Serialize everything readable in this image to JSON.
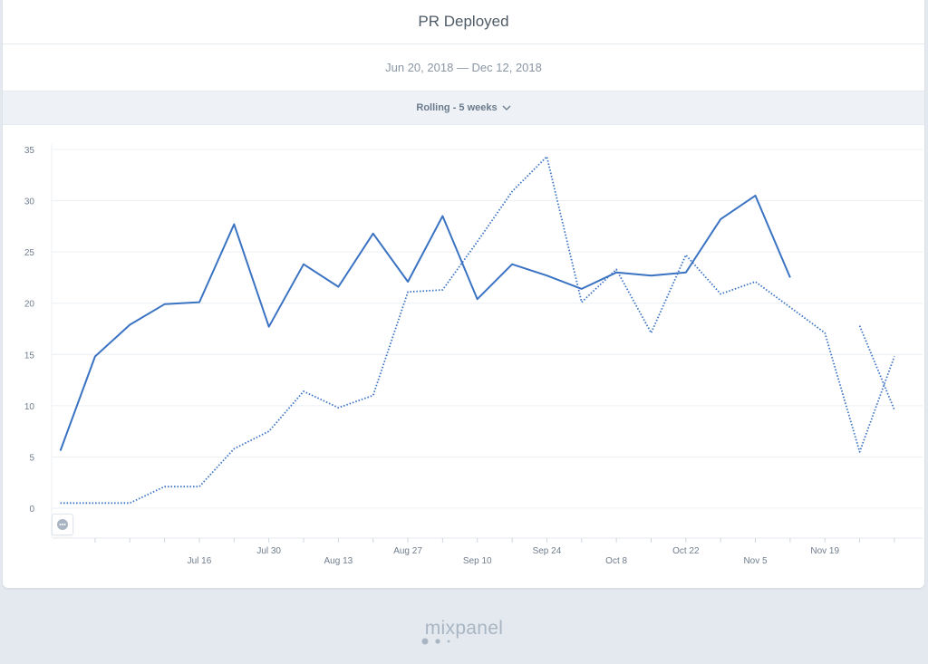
{
  "header": {
    "title": "PR Deployed"
  },
  "date_range": "Jun 20, 2018 — Dec 12, 2018",
  "rolling": {
    "label": "Rolling - 5 weeks"
  },
  "logo": "mixpanel",
  "colors": {
    "line": "#3b73c3",
    "grid": "#eceff3",
    "tick_text": "#6f7d8c",
    "background": "#e3e9ef"
  },
  "chart_data": {
    "type": "line",
    "ylim": [
      0,
      35
    ],
    "y_ticks": [
      0,
      5,
      10,
      15,
      20,
      25,
      30,
      35
    ],
    "x_ticks": [
      {
        "label": "Jul 16",
        "x": 4
      },
      {
        "label": "Jul 30",
        "x": 6
      },
      {
        "label": "Aug 13",
        "x": 8
      },
      {
        "label": "Aug 27",
        "x": 10
      },
      {
        "label": "Sep 10",
        "x": 12
      },
      {
        "label": "Sep 24",
        "x": 14
      },
      {
        "label": "Oct 8",
        "x": 16
      },
      {
        "label": "Oct 22",
        "x": 18
      },
      {
        "label": "Nov 5",
        "x": 20
      },
      {
        "label": "Nov 19",
        "x": 22
      }
    ],
    "x_range": [
      -0.25,
      24.55
    ],
    "series": [
      {
        "style": "solid",
        "x": [
          0,
          1,
          2,
          3,
          4,
          5,
          6,
          7,
          8,
          9,
          10,
          11,
          12,
          13,
          14,
          15,
          16,
          17,
          18,
          19,
          20,
          21,
          22,
          23,
          24
        ],
        "values": [
          5.6,
          14.8,
          17.9,
          19.9,
          20.1,
          27.7,
          17.7,
          23.8,
          21.6,
          26.8,
          22.1,
          28.5,
          20.4,
          23.8,
          22.7,
          21.4,
          23.0,
          22.7,
          23.0,
          28.2,
          30.5,
          22.5,
          null,
          17.8,
          null
        ]
      },
      {
        "style": "dotted",
        "x": [
          0,
          1,
          2,
          3,
          4,
          5,
          6,
          7,
          8,
          9,
          10,
          11,
          12,
          13,
          14,
          15,
          16,
          17,
          18,
          19,
          20,
          21,
          22,
          23,
          24
        ],
        "values": [
          0.5,
          0.5,
          0.5,
          2.1,
          2.1,
          5.8,
          7.5,
          11.4,
          9.8,
          11.0,
          21.1,
          21.3,
          26.0,
          30.9,
          34.3,
          20.1,
          23.3,
          17.1,
          24.7,
          20.9,
          22.1,
          19.6,
          17.1,
          5.5,
          14.8
        ]
      }
    ],
    "extra_segments": [
      {
        "style": "dotted",
        "from": [
          23,
          17.8
        ],
        "to": [
          24,
          9.6
        ]
      }
    ]
  }
}
